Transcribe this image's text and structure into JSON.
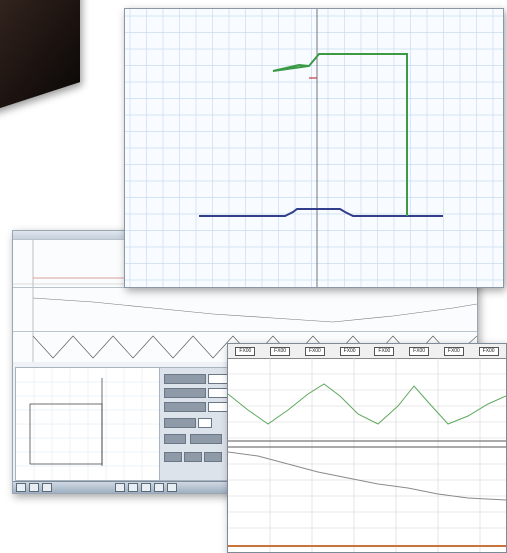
{
  "colors": {
    "trace_green": "#3a9a45",
    "trace_blue": "#343f8c",
    "trace_grey": "#8a8a8a",
    "trace_orange": "#c8743a",
    "grid": "#c9dcef",
    "axis": "#555555"
  },
  "scope": {
    "tabs": [
      "FX00",
      "FX00",
      "FX00",
      "FX00",
      "FX00",
      "FX00",
      "FX00",
      "FX00"
    ]
  },
  "icons": {
    "taskbar": [
      "start-icon",
      "app-icon",
      "app-icon",
      "app-icon",
      "folder-icon",
      "app-icon",
      "app-icon",
      "app-icon"
    ]
  }
}
